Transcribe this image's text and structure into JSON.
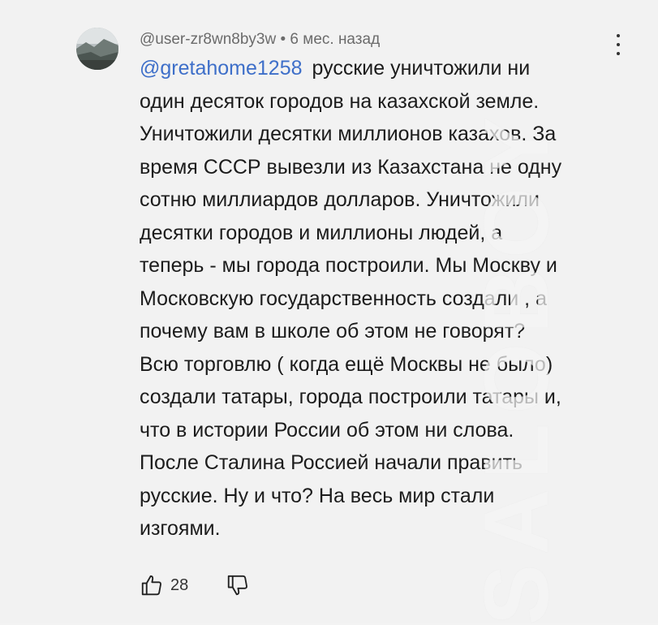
{
  "comment": {
    "username": "@user-zr8wn8by3w",
    "separator": "•",
    "time": "6 мес. назад",
    "mention": "@gretahome1258",
    "lines": [
      "русские уничтожили ни",
      "один десяток городов на казахской земле.",
      "Уничтожили десятки миллионов казахов. За",
      "время СССР вывезли из Казахстана не одну",
      "сотню миллиардов долларов. Уничтожили",
      "десятки городов и миллионы людей, а",
      "теперь - мы города построили. Мы Москву и",
      "Московскую государственность создали , а",
      "почему вам в школе об этом не говорят?",
      "Всю торговлю ( когда ещё Москвы не было)",
      "создали татары, города построили татары и,",
      "что в истории России об этом ни слова.",
      "После Сталина Россией начали править",
      "русские. Ну и что? На весь мир стали",
      "изгоями."
    ],
    "like_count": "28"
  },
  "icons": {
    "more": "more-vertical-icon",
    "like": "thumbs-up-icon",
    "dislike": "thumbs-down-icon"
  },
  "watermark": "SALOBOY"
}
